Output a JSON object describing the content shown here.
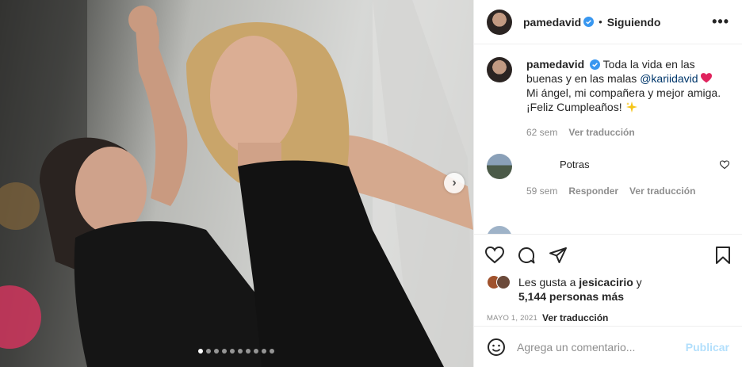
{
  "post": {
    "username": "pamedavid",
    "follow_status": "Siguiendo",
    "separator": "•",
    "more_label": "•••"
  },
  "caption": {
    "username": "pamedavid",
    "text_part1": "Toda la vida en las buenas y en las malas",
    "mention": "@kariidavid",
    "text_part2": "Mi ángel, mi compañera y mejor amiga. ¡Feliz Cumpleaños!",
    "time": "62 sem",
    "translate": "Ver traducción"
  },
  "comment": {
    "text": "Potras",
    "time": "59 sem",
    "reply": "Responder",
    "translate": "Ver traducción"
  },
  "likes": {
    "prefix": "Les gusta a",
    "user": "jesicacirio",
    "connector": "y",
    "others": "5,144 personas más"
  },
  "date": "MAYO 1, 2021",
  "date_translate": "Ver traducción",
  "add_comment": {
    "placeholder": "Agrega un comentario...",
    "publish": "Publicar"
  },
  "carousel": {
    "slides": 10,
    "current": 1
  },
  "colors": {
    "verified": "#3897f0",
    "heart_emoji": "#e0245e",
    "publish_disabled": "#b2dffc"
  },
  "icons": [
    "verified-icon",
    "heart-icon",
    "comment-icon",
    "share-icon",
    "bookmark-icon",
    "emoji-icon",
    "chevron-right-icon",
    "more-icon"
  ]
}
